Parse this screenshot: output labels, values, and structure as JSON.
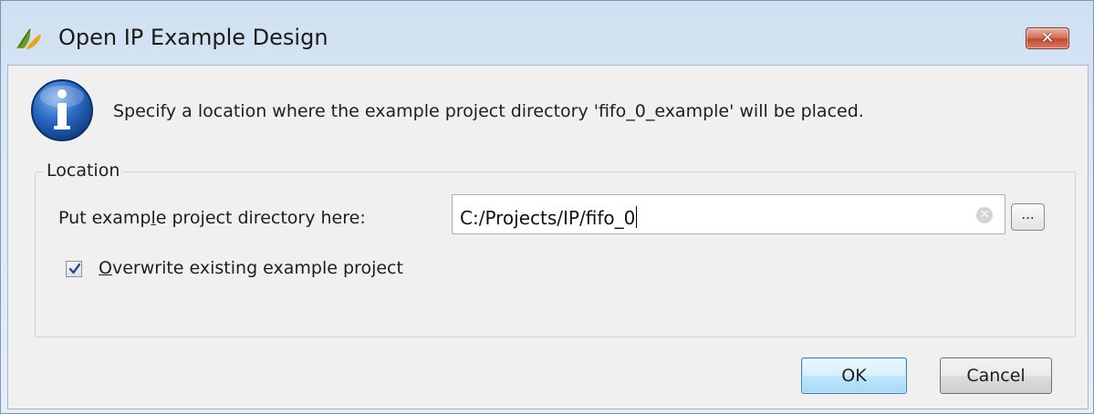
{
  "window": {
    "title": "Open IP Example Design",
    "close_label": "✕"
  },
  "message": {
    "text": "Specify a location where the example project directory 'fifo_0_example' will be placed."
  },
  "location_group": {
    "label": "Location",
    "directory": {
      "label_before": "Put examp",
      "label_mnemonic": "l",
      "label_after": "e project directory here:",
      "value": "C:/Projects/IP/fifo_0",
      "browse_label": "..."
    },
    "overwrite": {
      "checked": true,
      "label_mnemonic": "O",
      "label_after": "verwrite existing example project"
    }
  },
  "buttons": {
    "ok": "OK",
    "cancel": "Cancel"
  },
  "colors": {
    "title_gradient_top": "#cfe0f2",
    "close_red": "#c24a37",
    "info_blue": "#1e5eb4",
    "ok_border": "#3c7fb1"
  },
  "icons": {
    "app": "vivado-leaf-icon",
    "info": "info-icon",
    "clear": "clear-input-icon",
    "check": "checkmark-icon"
  }
}
